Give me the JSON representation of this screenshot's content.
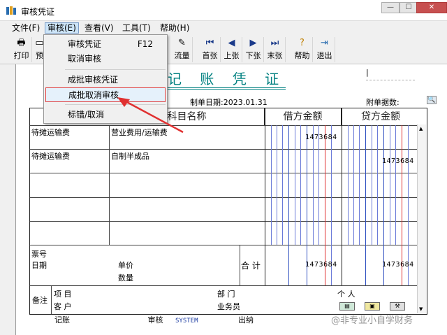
{
  "window": {
    "title": "审核凭证",
    "min_label": "—",
    "max_label": "☐",
    "close_label": "✕"
  },
  "menubar": [
    {
      "label": "文件(F)"
    },
    {
      "label": "审核(E)"
    },
    {
      "label": "查看(V)"
    },
    {
      "label": "工具(T)"
    },
    {
      "label": "帮助(H)"
    }
  ],
  "toolbar": {
    "print": "打印",
    "preview": "预",
    "flow": "流量",
    "first": "首张",
    "prev": "上张",
    "next": "下张",
    "last": "末张",
    "help": "帮助",
    "exit": "退出"
  },
  "dropdown": {
    "audit_voucher": "审核凭证",
    "audit_shortcut": "F12",
    "cancel_audit": "取消审核",
    "batch_audit": "成批审核凭证",
    "batch_cancel": "成批取消审核",
    "mark_error": "标错/取消"
  },
  "voucher": {
    "title": "记 账 凭 证",
    "date_label": "制单日期:",
    "date": "2023.01.31",
    "attach_label": "附单据数:",
    "headers": {
      "subject": "科目名称",
      "debit": "借方金额",
      "credit": "贷方金额"
    },
    "rows": [
      {
        "summary": "待摊运输费",
        "subject": "营业费用/运输费",
        "debit": "1473684",
        "credit": ""
      },
      {
        "summary": "待摊运输费",
        "subject": "自制半成品",
        "debit": "",
        "credit": "1473684"
      }
    ],
    "ticket_no": "票号",
    "ticket_date": "日期",
    "unit_price": "单价",
    "quantity": "数量",
    "total_label": "合 计",
    "total_debit": "1473684",
    "total_credit": "1473684",
    "remark": "备注",
    "project": "项  目",
    "customer": "客  户",
    "department": "部  门",
    "salesman": "业务员",
    "person": "个  人"
  },
  "footer": {
    "bookkeeping": "记账",
    "audit": "审核",
    "auditor": "SYSTEM",
    "cashier": "出纳"
  },
  "watermark": "@非专业小自学财务",
  "colors": {
    "accent": "#008080",
    "highlight_red": "#e03030",
    "menu_hover": "#cce4f7"
  }
}
